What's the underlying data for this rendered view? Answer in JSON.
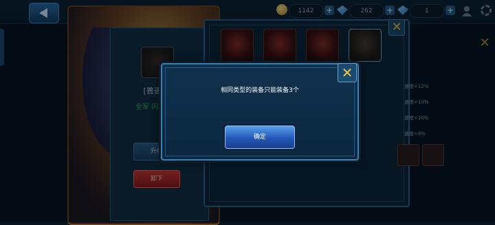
{
  "topbar": {
    "coin_amount": "1142",
    "crystal_amount": "262",
    "diamond_amount": "1"
  },
  "detail": {
    "name": "[普通] 天",
    "attribute": "全军 闪避率+2",
    "upgrade_label": "升级",
    "remove_label": "卸下"
  },
  "list_stats": [
    "速度+12%",
    "速度+10%",
    "速度+10%",
    "速度+8%"
  ],
  "modal": {
    "message": "相同类型的装备只能装备3个",
    "confirm_label": "确定"
  },
  "colors": {
    "modal_border": "#3e7fb0",
    "confirm_button": "#2458b8",
    "close_icon": "#f2c44c"
  }
}
